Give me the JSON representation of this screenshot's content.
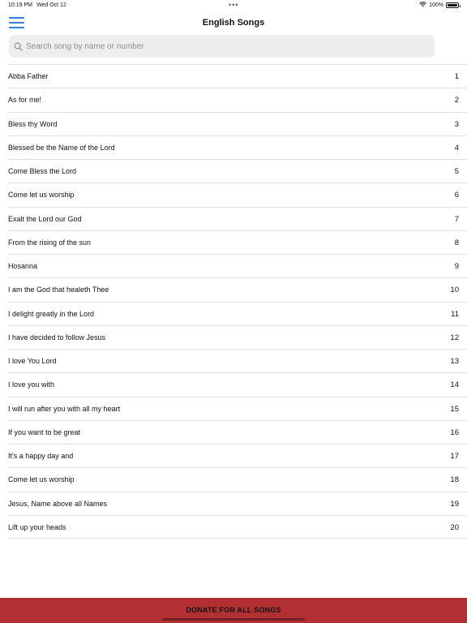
{
  "status_bar": {
    "time": "10:19 PM",
    "date": "Wed Oct 12",
    "multitask_dots": "•••",
    "battery_text": "100%",
    "battery_level": 1.0,
    "wifi_icon": "wifi-icon"
  },
  "nav": {
    "menu_icon": "hamburger-menu-icon",
    "title": "English Songs"
  },
  "search": {
    "placeholder": "Search song by name or number",
    "value": "",
    "icon": "search-icon"
  },
  "songs": [
    {
      "title": "Abba Father",
      "number": "1"
    },
    {
      "title": "As for me!",
      "number": "2"
    },
    {
      "title": "Bless thy Word",
      "number": "3"
    },
    {
      "title": "Blessed be the Name of the Lord",
      "number": "4"
    },
    {
      "title": "Come Bless the Lord",
      "number": "5"
    },
    {
      "title": "Come let us worship",
      "number": "6"
    },
    {
      "title": "Exalt the Lord our God",
      "number": "7"
    },
    {
      "title": "From the rising of the sun",
      "number": "8"
    },
    {
      "title": "Hosanna",
      "number": "9"
    },
    {
      "title": "I am the God that healeth Thee",
      "number": "10"
    },
    {
      "title": "I delight greatly in the Lord",
      "number": "11"
    },
    {
      "title": "I have decided to follow Jesus",
      "number": "12"
    },
    {
      "title": "I love You Lord",
      "number": "13"
    },
    {
      "title": "I love you with",
      "number": "14"
    },
    {
      "title": "I will run after you with all my heart",
      "number": "15"
    },
    {
      "title": "If you want to be great",
      "number": "16"
    },
    {
      "title": "It's a happy day and",
      "number": "17"
    },
    {
      "title": "Come let us worship",
      "number": "18"
    },
    {
      "title": "Jesus, Name above all Names",
      "number": "19"
    },
    {
      "title": "Lift up your heads",
      "number": "20"
    }
  ],
  "donate": {
    "label": "DONATE FOR ALL SONGS"
  },
  "colors": {
    "accent": "#2f7fe0",
    "donate_bar": "#b33032",
    "search_bg": "#eeeeef",
    "separator": "#e1e1e4"
  }
}
